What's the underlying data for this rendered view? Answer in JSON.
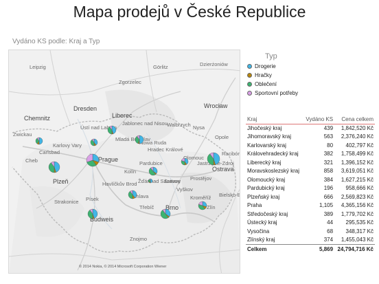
{
  "title": "Mapa prodejů v České Republice",
  "map": {
    "title": "Vydáno KS podle: Kraj a Typ",
    "copyright": "© 2014 Nokia, © 2014 Microsoft Corporation Wiener",
    "labels": [
      "Görlitz",
      "Zgorzelec",
      "Dzierżoniów",
      "Wrocław",
      "Opole",
      "Liberec",
      "Jablonec nad Nisou",
      "Ústí nad Labem",
      "Mladá Boleslav",
      "Walbrzych",
      "Dresden",
      "Chemnitz",
      "Zwickau",
      "Karlovy Vary",
      "Carlsbad",
      "Cheb",
      "Plzeň",
      "Prague",
      "Kolín",
      "Pardubice",
      "Hradec Králové",
      "Nowa Ruda",
      "Strakonice",
      "Písek",
      "Budweis",
      "Jihlava",
      "Brno",
      "Olomouc",
      "Prostějov",
      "Zlín",
      "Ostrava",
      "Jastrzębie-Zdrój",
      "Bielsko-Biała",
      "Havlíčkův Brod",
      "Žďár nad Sázavou",
      "Třebíč",
      "Svitavy",
      "Znojmo",
      "Kroměříž",
      "Vyškov",
      "Nysa",
      "Racibórz",
      "Leipzig"
    ]
  },
  "legend": {
    "title": "Typ",
    "items": [
      {
        "label": "Drogerie",
        "color": "#41b6e6"
      },
      {
        "label": "Hračky",
        "color": "#b8860b"
      },
      {
        "label": "Oblečení",
        "color": "#3cb371"
      },
      {
        "label": "Sportovní potřeby",
        "color": "#d9a0e6"
      }
    ]
  },
  "table": {
    "headers": [
      "Kraj",
      "Vydáno KS",
      "Cena celkem"
    ],
    "rows": [
      [
        "Jihočeský kraj",
        "439",
        "1,842,520 Kč"
      ],
      [
        "Jihomoravský kraj",
        "563",
        "2,376,240 Kč"
      ],
      [
        "Karlovarský kraj",
        "80",
        "402,797 Kč"
      ],
      [
        "Královehradecký kraj",
        "382",
        "1,758,499 Kč"
      ],
      [
        "Liberecký kraj",
        "321",
        "1,396,152 Kč"
      ],
      [
        "Moravskoslezský kraj",
        "858",
        "3,619,051 Kč"
      ],
      [
        "Olomoucký kraj",
        "384",
        "1,627,215 Kč"
      ],
      [
        "Pardubický kraj",
        "196",
        "958,666 Kč"
      ],
      [
        "Plzeňský kraj",
        "666",
        "2,569,823 Kč"
      ],
      [
        "Praha",
        "1,105",
        "4,365,156 Kč"
      ],
      [
        "Středočeský kraj",
        "389",
        "1,779,702 Kč"
      ],
      [
        "Ústecký kraj",
        "44",
        "295,535 Kč"
      ],
      [
        "Vysočina",
        "68",
        "348,317 Kč"
      ],
      [
        "Zlínský kraj",
        "374",
        "1,455,043 Kč"
      ]
    ],
    "total": [
      "Celkem",
      "5,869",
      "24,794,716 Kč"
    ]
  }
}
